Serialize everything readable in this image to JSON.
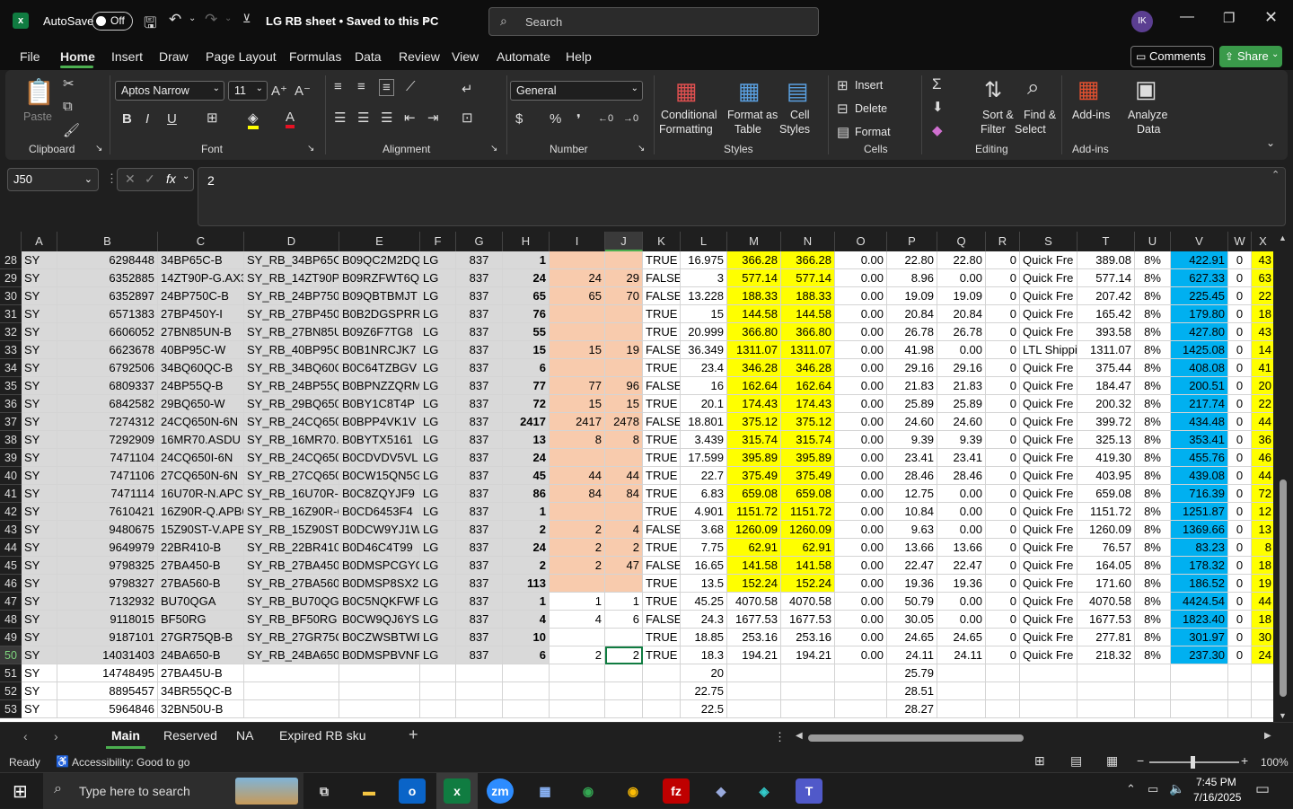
{
  "titlebar": {
    "autosave_label": "AutoSave",
    "toggle_label": "Off",
    "doc_title": "LG RB sheet • Saved to this PC",
    "search_placeholder": "Search",
    "avatar_initials": "IK"
  },
  "menu": {
    "tabs": [
      "File",
      "Home",
      "Insert",
      "Draw",
      "Page Layout",
      "Formulas",
      "Data",
      "Review",
      "View",
      "Automate",
      "Help"
    ],
    "active": "Home",
    "comments_label": "Comments",
    "share_label": "Share"
  },
  "ribbon": {
    "clipboard": {
      "paste": "Paste",
      "group": "Clipboard"
    },
    "font": {
      "family": "Aptos Narrow",
      "size": "11",
      "group": "Font"
    },
    "alignment": {
      "group": "Alignment"
    },
    "number": {
      "format": "General",
      "group": "Number"
    },
    "styles": {
      "cond1": "Conditional",
      "cond2": "Formatting",
      "fmt1": "Format as",
      "fmt2": "Table",
      "cell1": "Cell",
      "cell2": "Styles",
      "group": "Styles"
    },
    "cells": {
      "insert": "Insert",
      "delete": "Delete",
      "format": "Format",
      "group": "Cells"
    },
    "editing": {
      "sort1": "Sort &",
      "sort2": "Filter",
      "find1": "Find &",
      "find2": "Select",
      "group": "Editing"
    },
    "addins": {
      "addins": "Add-ins",
      "analyze1": "Analyze",
      "analyze2": "Data",
      "group": "Add-ins"
    }
  },
  "formula": {
    "namebox": "J50",
    "fx": "fx",
    "value": "2"
  },
  "columns": [
    "A",
    "B",
    "C",
    "D",
    "E",
    "F",
    "G",
    "H",
    "I",
    "J",
    "K",
    "L",
    "M",
    "N",
    "O",
    "P",
    "Q",
    "R",
    "S",
    "T",
    "U",
    "V",
    "W",
    "X"
  ],
  "rows": [
    {
      "n": "28",
      "c": [
        "SY",
        "6298448",
        "34BP65C-B",
        "SY_RB_34BP65C-E",
        "B09QC2M2DQ",
        "LG",
        "837",
        "1",
        "",
        "",
        "TRUE",
        "16.975",
        "366.28",
        "366.28",
        "0.00",
        "22.80",
        "22.80",
        "0",
        "Quick Fre",
        "389.08",
        "8%",
        "422.91",
        "0",
        "43"
      ]
    },
    {
      "n": "29",
      "c": [
        "SY",
        "6352885",
        "14ZT90P-G.AX3",
        "SY_RB_14ZT90P-G",
        "B09RZFWT6Q",
        "LG",
        "837",
        "24",
        "24",
        "29",
        "FALSE",
        "3",
        "577.14",
        "577.14",
        "0.00",
        "8.96",
        "0.00",
        "0",
        "Quick Fre",
        "577.14",
        "8%",
        "627.33",
        "0",
        "63"
      ]
    },
    {
      "n": "30",
      "c": [
        "SY",
        "6352897",
        "24BP750C-B",
        "SY_RB_24BP750C",
        "B09QBTBMJT",
        "LG",
        "837",
        "65",
        "65",
        "70",
        "FALSE",
        "13.228",
        "188.33",
        "188.33",
        "0.00",
        "19.09",
        "19.09",
        "0",
        "Quick Fre",
        "207.42",
        "8%",
        "225.45",
        "0",
        "22"
      ]
    },
    {
      "n": "31",
      "c": [
        "SY",
        "6571383",
        "27BP450Y-I",
        "SY_RB_27BP450Y-",
        "B0B2DGSPRR",
        "LG",
        "837",
        "76",
        "",
        "",
        "TRUE",
        "15",
        "144.58",
        "144.58",
        "0.00",
        "20.84",
        "20.84",
        "0",
        "Quick Fre",
        "165.42",
        "8%",
        "179.80",
        "0",
        "18"
      ]
    },
    {
      "n": "32",
      "c": [
        "SY",
        "6606052",
        "27BN85UN-B",
        "SY_RB_27BN85UN",
        "B09Z6F7TG8",
        "LG",
        "837",
        "55",
        "",
        "",
        "TRUE",
        "20.999",
        "366.80",
        "366.80",
        "0.00",
        "26.78",
        "26.78",
        "0",
        "Quick Fre",
        "393.58",
        "8%",
        "427.80",
        "0",
        "43"
      ]
    },
    {
      "n": "33",
      "c": [
        "SY",
        "6623678",
        "40BP95C-W",
        "SY_RB_40BP95C-V",
        "B0B1NRCJK7",
        "LG",
        "837",
        "15",
        "15",
        "19",
        "FALSE",
        "36.349",
        "1311.07",
        "1311.07",
        "0.00",
        "41.98",
        "0.00",
        "0",
        "LTL Shippi",
        "1311.07",
        "8%",
        "1425.08",
        "0",
        "14"
      ]
    },
    {
      "n": "34",
      "c": [
        "SY",
        "6792506",
        "34BQ60QC-B",
        "SY_RB_34BQ60QC",
        "B0C64TZBGV",
        "LG",
        "837",
        "6",
        "",
        "",
        "TRUE",
        "23.4",
        "346.28",
        "346.28",
        "0.00",
        "29.16",
        "29.16",
        "0",
        "Quick Fre",
        "375.44",
        "8%",
        "408.08",
        "0",
        "41"
      ]
    },
    {
      "n": "35",
      "c": [
        "SY",
        "6809337",
        "24BP55Q-B",
        "SY_RB_24BP55Q-",
        "B0BPNZZQRM",
        "LG",
        "837",
        "77",
        "77",
        "96",
        "FALSE",
        "16",
        "162.64",
        "162.64",
        "0.00",
        "21.83",
        "21.83",
        "0",
        "Quick Fre",
        "184.47",
        "8%",
        "200.51",
        "0",
        "20"
      ]
    },
    {
      "n": "36",
      "c": [
        "SY",
        "6842582",
        "29BQ650-W",
        "SY_RB_29BQ650-V",
        "B0BY1C8T4P",
        "LG",
        "837",
        "72",
        "15",
        "15",
        "TRUE",
        "20.1",
        "174.43",
        "174.43",
        "0.00",
        "25.89",
        "25.89",
        "0",
        "Quick Fre",
        "200.32",
        "8%",
        "217.74",
        "0",
        "22"
      ]
    },
    {
      "n": "37",
      "c": [
        "SY",
        "7274312",
        "24CQ650N-6N",
        "SY_RB_24CQ650N",
        "B0BPP4VK1V",
        "LG",
        "837",
        "2417",
        "2417",
        "2478",
        "FALSE",
        "18.801",
        "375.12",
        "375.12",
        "0.00",
        "24.60",
        "24.60",
        "0",
        "Quick Fre",
        "399.72",
        "8%",
        "434.48",
        "0",
        "44"
      ]
    },
    {
      "n": "38",
      "c": [
        "SY",
        "7292909",
        "16MR70.ASDU",
        "SY_RB_16MR70.AS",
        "B0BYTX5161",
        "LG",
        "837",
        "13",
        "8",
        "8",
        "TRUE",
        "3.439",
        "315.74",
        "315.74",
        "0.00",
        "9.39",
        "9.39",
        "0",
        "Quick Fre",
        "325.13",
        "8%",
        "353.41",
        "0",
        "36"
      ]
    },
    {
      "n": "39",
      "c": [
        "SY",
        "7471104",
        "24CQ650I-6N",
        "SY_RB_24CQ650I-",
        "B0CDVDV5VL",
        "LG",
        "837",
        "24",
        "",
        "",
        "TRUE",
        "17.599",
        "395.89",
        "395.89",
        "0.00",
        "23.41",
        "23.41",
        "0",
        "Quick Fre",
        "419.30",
        "8%",
        "455.76",
        "0",
        "46"
      ]
    },
    {
      "n": "40",
      "c": [
        "SY",
        "7471106",
        "27CQ650N-6N",
        "SY_RB_27CQ650N",
        "B0CW15QN5G",
        "LG",
        "837",
        "45",
        "44",
        "44",
        "TRUE",
        "22.7",
        "375.49",
        "375.49",
        "0.00",
        "28.46",
        "28.46",
        "0",
        "Quick Fre",
        "403.95",
        "8%",
        "439.08",
        "0",
        "44"
      ]
    },
    {
      "n": "41",
      "c": [
        "SY",
        "7471114",
        "16U70R-N.APC5",
        "SY_RB_16U70R-N",
        "B0C8ZQYJF9",
        "LG",
        "837",
        "86",
        "84",
        "84",
        "TRUE",
        "6.83",
        "659.08",
        "659.08",
        "0.00",
        "12.75",
        "0.00",
        "0",
        "Quick Fre",
        "659.08",
        "8%",
        "716.39",
        "0",
        "72"
      ]
    },
    {
      "n": "42",
      "c": [
        "SY",
        "7610421",
        "16Z90R-Q.APB6",
        "SY_RB_16Z90R-Q.",
        "B0CD6453F4",
        "LG",
        "837",
        "1",
        "",
        "",
        "TRUE",
        "4.901",
        "1151.72",
        "1151.72",
        "0.00",
        "10.84",
        "0.00",
        "0",
        "Quick Fre",
        "1151.72",
        "8%",
        "1251.87",
        "0",
        "12"
      ]
    },
    {
      "n": "43",
      "c": [
        "SY",
        "9480675",
        "15Z90ST-V.APB6",
        "SY_RB_15Z90ST-V",
        "B0DCW9YJ1W",
        "LG",
        "837",
        "2",
        "2",
        "4",
        "FALSE",
        "3.68",
        "1260.09",
        "1260.09",
        "0.00",
        "9.63",
        "0.00",
        "0",
        "Quick Fre",
        "1260.09",
        "8%",
        "1369.66",
        "0",
        "13"
      ]
    },
    {
      "n": "44",
      "c": [
        "SY",
        "9649979",
        "22BR410-B",
        "SY_RB_22BR410-E",
        "B0D46C4T99",
        "LG",
        "837",
        "24",
        "2",
        "2",
        "TRUE",
        "7.75",
        "62.91",
        "62.91",
        "0.00",
        "13.66",
        "13.66",
        "0",
        "Quick Fre",
        "76.57",
        "8%",
        "83.23",
        "0",
        "8"
      ]
    },
    {
      "n": "45",
      "c": [
        "SY",
        "9798325",
        "27BA450-B",
        "SY_RB_27BA450-E",
        "B0DMSPCGYQ",
        "LG",
        "837",
        "2",
        "2",
        "47",
        "FALSE",
        "16.65",
        "141.58",
        "141.58",
        "0.00",
        "22.47",
        "22.47",
        "0",
        "Quick Fre",
        "164.05",
        "8%",
        "178.32",
        "0",
        "18"
      ]
    },
    {
      "n": "46",
      "c": [
        "SY",
        "9798327",
        "27BA560-B",
        "SY_RB_27BA560-E",
        "B0DMSP8SX2",
        "LG",
        "837",
        "113",
        "",
        "",
        "TRUE",
        "13.5",
        "152.24",
        "152.24",
        "0.00",
        "19.36",
        "19.36",
        "0",
        "Quick Fre",
        "171.60",
        "8%",
        "186.52",
        "0",
        "19"
      ]
    },
    {
      "n": "47",
      "c": [
        "SY",
        "7132932",
        "BU70QGA",
        "SY_RB_BU70QGA",
        "B0C5NQKFWP",
        "LG",
        "837",
        "1",
        "1",
        "1",
        "TRUE",
        "45.25",
        "4070.58",
        "4070.58",
        "0.00",
        "50.79",
        "0.00",
        "0",
        "Quick Fre",
        "4070.58",
        "8%",
        "4424.54",
        "0",
        "44"
      ]
    },
    {
      "n": "48",
      "c": [
        "SY",
        "9118015",
        "BF50RG",
        "SY_RB_BF50RG",
        "B0CW9QJ6YS",
        "LG",
        "837",
        "4",
        "4",
        "6",
        "FALSE",
        "24.3",
        "1677.53",
        "1677.53",
        "0.00",
        "30.05",
        "0.00",
        "0",
        "Quick Fre",
        "1677.53",
        "8%",
        "1823.40",
        "0",
        "18"
      ]
    },
    {
      "n": "49",
      "c": [
        "SY",
        "9187101",
        "27GR75QB-B",
        "SY_RB_27GR75QE",
        "B0CZWSBTWR",
        "LG",
        "837",
        "10",
        "",
        "",
        "TRUE",
        "18.85",
        "253.16",
        "253.16",
        "0.00",
        "24.65",
        "24.65",
        "0",
        "Quick Fre",
        "277.81",
        "8%",
        "301.97",
        "0",
        "30"
      ]
    },
    {
      "n": "50",
      "c": [
        "SY",
        "14031403",
        "24BA650-B",
        "SY_RB_24BA650-E",
        "B0DMSPBVNF",
        "LG",
        "837",
        "6",
        "2",
        "2",
        "TRUE",
        "18.3",
        "194.21",
        "194.21",
        "0.00",
        "24.11",
        "24.11",
        "0",
        "Quick Fre",
        "218.32",
        "8%",
        "237.30",
        "0",
        "24"
      ]
    },
    {
      "n": "51",
      "c": [
        "SY",
        "14748495",
        "27BA45U-B",
        "",
        "",
        "",
        "",
        "",
        "",
        "",
        "",
        "20",
        "",
        "",
        "",
        "25.79",
        "",
        "",
        "",
        "",
        "",
        "",
        "",
        ""
      ]
    },
    {
      "n": "52",
      "c": [
        "SY",
        "8895457",
        "34BR55QC-B",
        "",
        "",
        "",
        "",
        "",
        "",
        "",
        "",
        "22.75",
        "",
        "",
        "",
        "28.51",
        "",
        "",
        "",
        "",
        "",
        "",
        "",
        ""
      ]
    },
    {
      "n": "53",
      "c": [
        "SY",
        "5964846",
        "32BN50U-B",
        "",
        "",
        "",
        "",
        "",
        "",
        "",
        "",
        "22.5",
        "",
        "",
        "",
        "28.27",
        "",
        "",
        "",
        "",
        "",
        "",
        "",
        ""
      ]
    }
  ],
  "sheets": [
    "Main",
    "Reserved",
    "NA",
    "Expired RB sku"
  ],
  "active_sheet": "Main",
  "status": {
    "ready": "Ready",
    "accessibility": "Accessibility: Good to go",
    "zoom": "100%"
  },
  "taskbar": {
    "search_placeholder": "Type here to search",
    "time": "7:45 PM",
    "date": "7/16/2025"
  }
}
